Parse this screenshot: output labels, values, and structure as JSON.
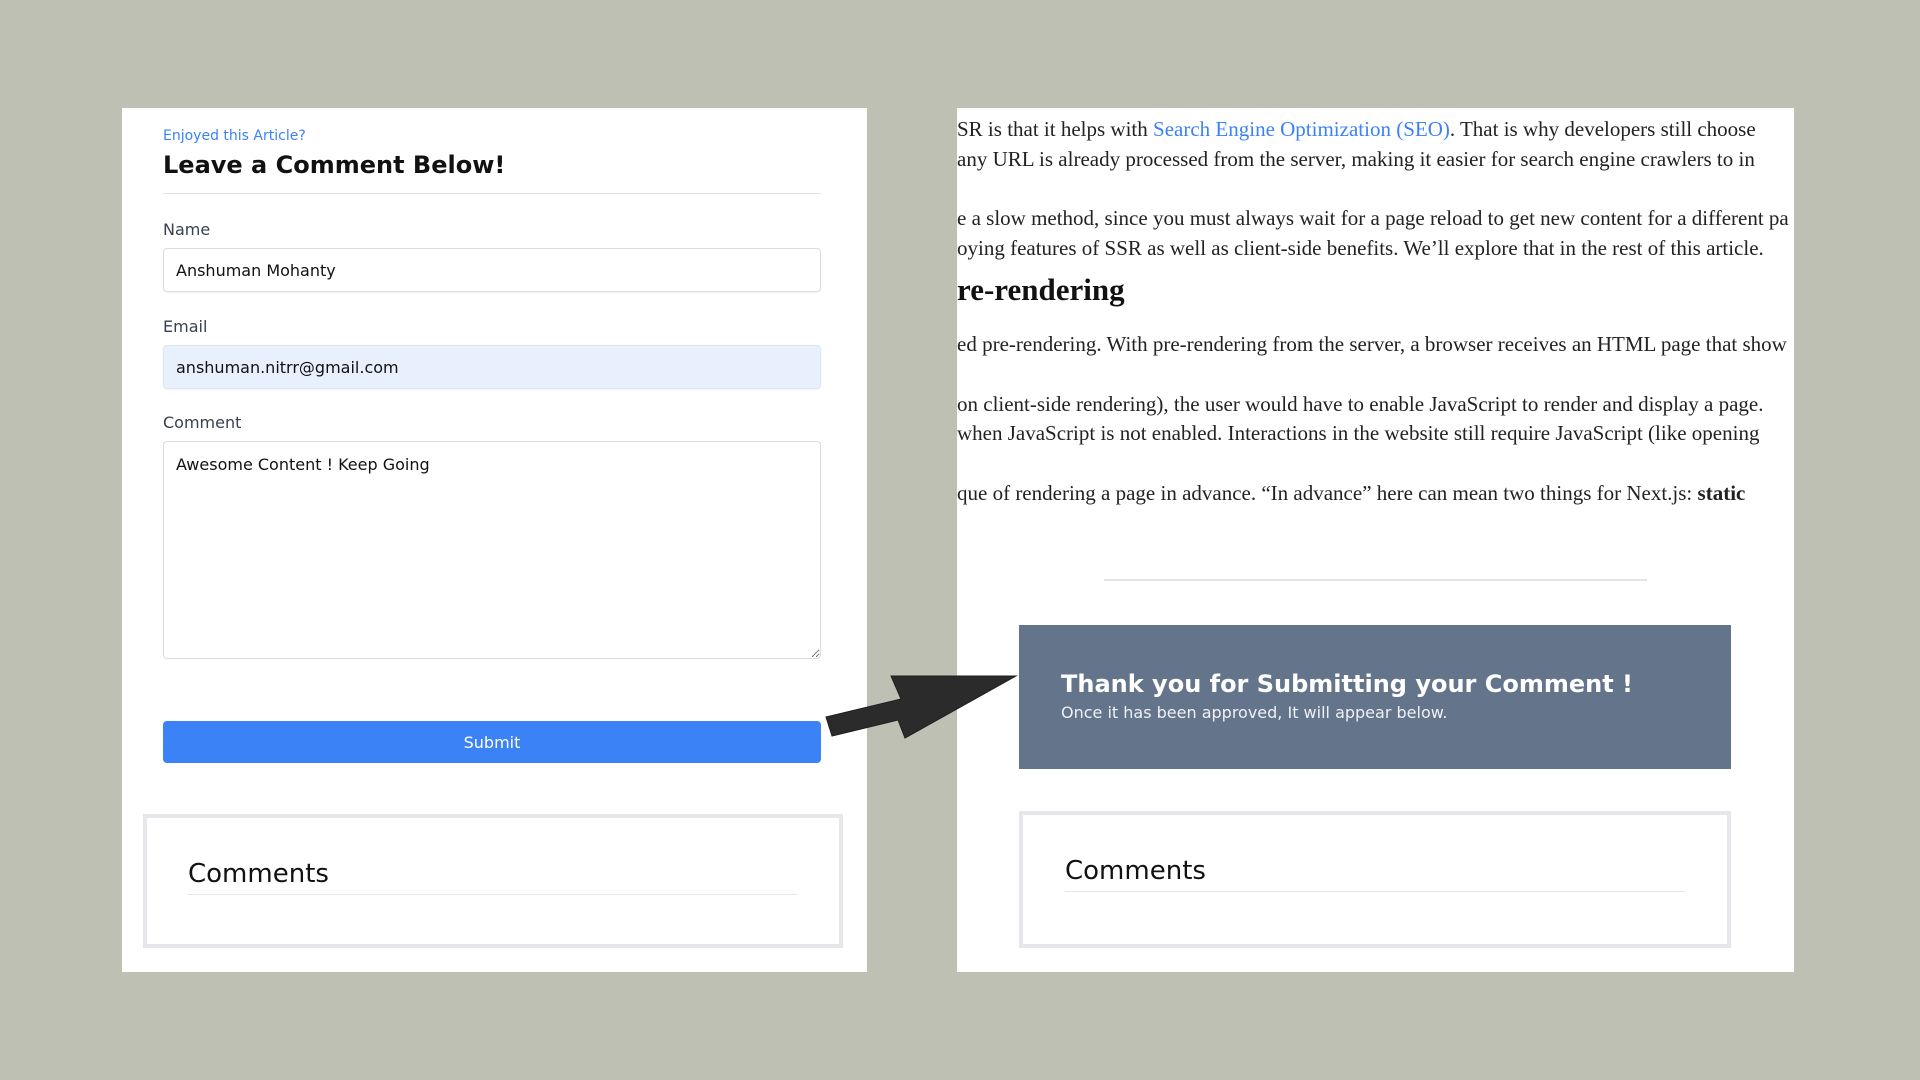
{
  "comment_form": {
    "kicker": "Enjoyed this Article?",
    "title": "Leave a Comment Below!",
    "name_label": "Name",
    "name_value": "Anshuman Mohanty",
    "email_label": "Email",
    "email_value": "anshuman.nitrr@gmail.com",
    "comment_label": "Comment",
    "comment_value": "Awesome Content ! Keep Going",
    "submit_label": "Submit"
  },
  "comments_section": {
    "title": "Comments"
  },
  "article": {
    "lines": [
      {
        "pre": "SR is that it helps with ",
        "link": "Search Engine Optimization (SEO)",
        "post": ". That is why developers still choose"
      },
      {
        "pre": " any URL is already processed from the server, making it easier for search engine crawlers to in"
      },
      {
        "pre": "e a slow method, since you must always wait for a page reload to get new content for a different pa"
      },
      {
        "pre": "oying features of SSR as well as client-side benefits. We’ll explore that in the rest of this article."
      },
      {
        "pre": "ed pre-rendering. With pre-rendering from the server, a browser receives an HTML page that show"
      },
      {
        "pre": " on client-side rendering), the user would have to enable JavaScript to render and display a page."
      },
      {
        "pre": "when JavaScript is not enabled. Interactions in the website still require JavaScript (like opening"
      },
      {
        "pre": "que of rendering a page in advance. “In advance” here can mean two things for Next.js: ",
        "bold": "static"
      }
    ],
    "heading": "re-rendering"
  },
  "confirmation": {
    "title": "Thank you for Submitting your Comment !",
    "subtitle": "Once it has been approved, It will appear below."
  },
  "colors": {
    "background": "#bec0b3",
    "accent": "#3b82f6",
    "banner": "#64748b",
    "arrow": "#2b2b2b"
  },
  "icons": {
    "arrow": "right-pointing-arrow",
    "textarea_resize": "resize-handle-icon"
  }
}
